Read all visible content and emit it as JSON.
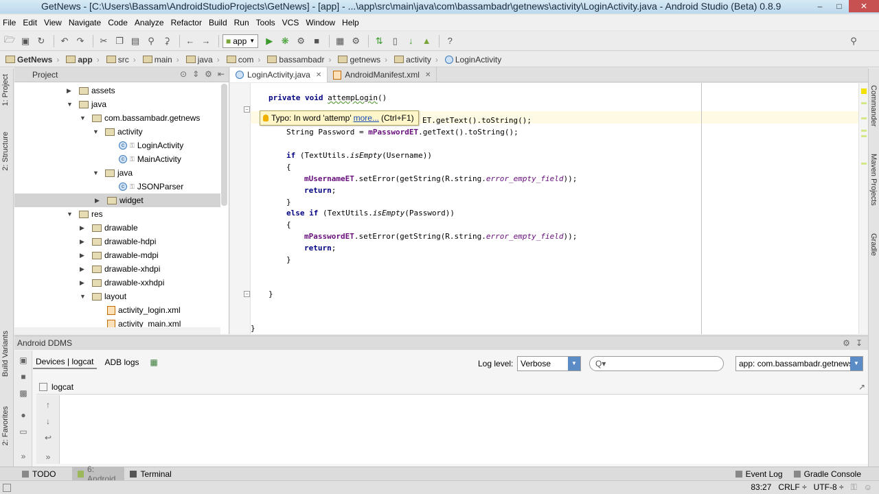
{
  "window": {
    "title": "GetNews - [C:\\Users\\Bassam\\AndroidStudioProjects\\GetNews] - [app] - ...\\app\\src\\main\\java\\com\\bassambadr\\getnews\\activity\\LoginActivity.java - Android Studio (Beta) 0.8.9"
  },
  "menu": [
    "File",
    "Edit",
    "View",
    "Navigate",
    "Code",
    "Analyze",
    "Refactor",
    "Build",
    "Run",
    "Tools",
    "VCS",
    "Window",
    "Help"
  ],
  "toolbar": {
    "run_config": "app"
  },
  "breadcrumbs": [
    "GetNews",
    "app",
    "src",
    "main",
    "java",
    "com",
    "bassambadr",
    "getnews",
    "activity",
    "LoginActivity"
  ],
  "left_tabs": [
    "1: Project",
    "2: Structure",
    "Build Variants",
    "2: Favorites"
  ],
  "right_tabs": [
    "Commander",
    "Maven Projects",
    "Gradle"
  ],
  "project_panel": {
    "title": "Project",
    "tree": [
      {
        "label": "assets",
        "icon": "folder"
      },
      {
        "label": "java",
        "icon": "folder"
      },
      {
        "label": "com.bassambadr.getnews",
        "icon": "folder"
      },
      {
        "label": "activity",
        "icon": "folder"
      },
      {
        "label": "LoginActivity",
        "icon": "class"
      },
      {
        "label": "MainActivity",
        "icon": "class"
      },
      {
        "label": "java",
        "icon": "folder"
      },
      {
        "label": "JSONParser",
        "icon": "class"
      },
      {
        "label": "widget",
        "icon": "folder"
      },
      {
        "label": "res",
        "icon": "folder"
      },
      {
        "label": "drawable",
        "icon": "folder"
      },
      {
        "label": "drawable-hdpi",
        "icon": "folder"
      },
      {
        "label": "drawable-mdpi",
        "icon": "folder"
      },
      {
        "label": "drawable-xhdpi",
        "icon": "folder"
      },
      {
        "label": "drawable-xxhdpi",
        "icon": "folder"
      },
      {
        "label": "layout",
        "icon": "folder"
      },
      {
        "label": "activity_login.xml",
        "icon": "xml"
      },
      {
        "label": "activity_main.xml",
        "icon": "xml"
      }
    ]
  },
  "editor": {
    "tabs": [
      "LoginActivity.java",
      "AndroidManifest.xml"
    ],
    "active_tab": "LoginActivity.java",
    "code": {
      "l1_kw": "private void ",
      "l1_name": "attempLogin",
      "l1_rest": "()",
      "l3_end": "ET.getText().toString();",
      "l4_decl": "String Password = ",
      "l4_field": "mPasswordET",
      "l4_rest": ".getText().toString();",
      "l5_kw": "if",
      "l5_a": " (TextUtils.",
      "l5_m": "isEmpty",
      "l5_b": "(Username))",
      "brace_open": "{",
      "brace_close": "}",
      "l7_field": "mUsernameET",
      "l7_a": ".setError(getString(R.string.",
      "l7_const": "error_empty_field",
      "l7_b": "));",
      "return_kw": "return",
      "semi": ";",
      "l9_kw": "else if",
      "l9_a": " (TextUtils.",
      "l9_m": "isEmpty",
      "l9_b": "(Password))",
      "l11_field": "mPasswordET",
      "l11_a": ".setError(getString(R.string.",
      "l11_const": "error_empty_field",
      "l11_b": "));"
    },
    "tooltip": {
      "text": "Typo: In word 'attemp'",
      "link": "more...",
      "shortcut": "(Ctrl+F1)"
    }
  },
  "ddms": {
    "title": "Android DDMS",
    "tabs": [
      "Devices | logcat",
      "ADB logs"
    ],
    "log_level_label": "Log level:",
    "log_level": "Verbose",
    "search_placeholder": "Q▾",
    "app_filter": "app: com.bassambadr.getnews",
    "logcat_label": "logcat"
  },
  "bottom_tabs": [
    "TODO",
    "6: Android",
    "Terminal",
    "Event Log",
    "Gradle Console"
  ],
  "status": {
    "position": "83:27",
    "line_sep": "CRLF ÷",
    "encoding": "UTF-8 ÷"
  }
}
